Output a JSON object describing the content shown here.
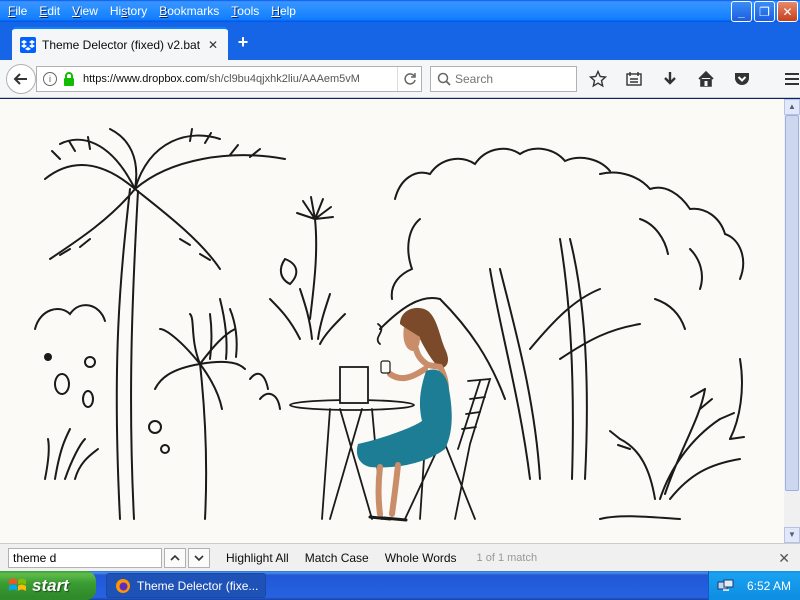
{
  "menu": {
    "items": [
      {
        "prefix": "",
        "key": "F",
        "rest": "ile"
      },
      {
        "prefix": "",
        "key": "E",
        "rest": "dit"
      },
      {
        "prefix": "",
        "key": "V",
        "rest": "iew"
      },
      {
        "prefix": "Hi",
        "key": "s",
        "rest": "tory"
      },
      {
        "prefix": "",
        "key": "B",
        "rest": "ookmarks"
      },
      {
        "prefix": "",
        "key": "T",
        "rest": "ools"
      },
      {
        "prefix": "",
        "key": "H",
        "rest": "elp"
      }
    ]
  },
  "window": {
    "minimize": "_",
    "maximize": "❐",
    "close": "✕"
  },
  "tab": {
    "title": "Theme Delector (fixed) v2.bat",
    "close": "✕",
    "new_tab": "+"
  },
  "nav": {
    "url_host": "https://www.dropbox.com",
    "url_path": "/sh/cl9bu4qjxhk2liu/AAAem5vM",
    "search_placeholder": "Search"
  },
  "findbar": {
    "query": "theme d",
    "highlight_all": "Highlight All",
    "highlight_all_key": "l",
    "match_case": "Match Case",
    "match_case_key": "C",
    "whole_words": "Whole Words",
    "whole_words_key": "W",
    "status": "1 of 1 match"
  },
  "taskbar": {
    "start_label": "start",
    "task_title": "Theme Delector (fixe...",
    "clock": "6:52 AM"
  },
  "colors": {
    "dress": "#1c7d94",
    "hair": "#7a4a2a",
    "skin": "#c98d6a",
    "ink": "#1a1a1a"
  }
}
